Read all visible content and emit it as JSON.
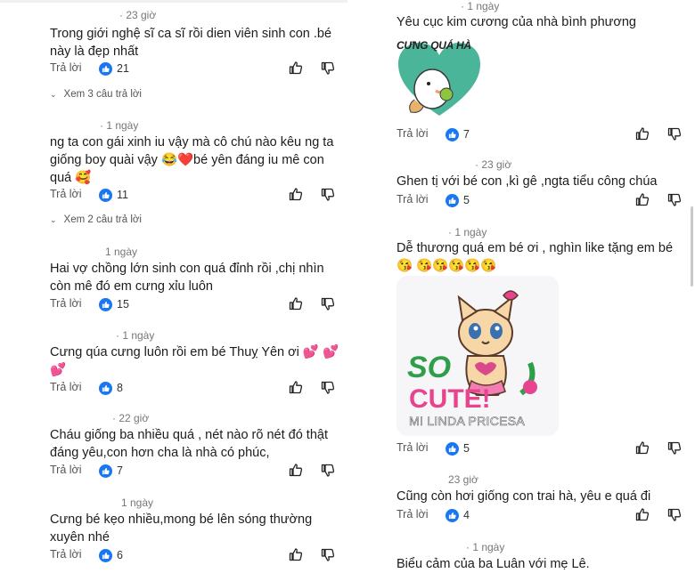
{
  "colors": {
    "like_blue": "#1a77f2",
    "text": "#1c1c1c",
    "meta": "#777777"
  },
  "reply_label": "Trả lời",
  "left": {
    "comments": [
      {
        "time": "· 23 giờ",
        "text": "Trong giới nghệ sĩ ca sĩ rồi dien viên sinh con .bé này là đẹp nhất",
        "likes": "21",
        "more_replies": "Xem 3 câu trả lời"
      },
      {
        "time": "· 1 ngày",
        "text": "ng ta con gái xinh iu vậy mà cô chú nào kêu ng ta giống boy quài vậy 😂❤️bé yên đáng iu mê con quá 🥰",
        "likes": "11",
        "more_replies": "Xem 2 câu trả lời"
      },
      {
        "time": "1 ngày",
        "text": "Hai vợ chồng lớn sinh con quá đỉnh rồi ,chị nhìn còn mê đó em cưng xỉu luôn",
        "likes": "15"
      },
      {
        "time": "· 1 ngày",
        "text": "Cưng qúa cưng luôn rồi em bé Thuỵ Yên ơi 💕 💕 💕",
        "likes": "8"
      },
      {
        "time": "· 22 giờ",
        "text": "Cháu giống ba nhiều quá , nét nào rõ nét đó thật đáng yêu,con hơn cha là nhà có phúc,",
        "likes": "7"
      },
      {
        "time": "1 ngày",
        "text": "Cưng bé kẹo nhiều,mong bé lên sóng thường xuyên nhé",
        "likes": "6"
      }
    ]
  },
  "right": {
    "comments": [
      {
        "time": "· 1 ngày",
        "text": "Yêu cục kim cương của nhà bình phương",
        "likes": "7",
        "sticker": {
          "type": "heart-sticker",
          "caption": "CƯNG QUÁ HÀ"
        }
      },
      {
        "time": "· 23 giờ",
        "text": "Ghen tị với bé con ,kì gê ,ngta tiểu công chúa",
        "likes": "5"
      },
      {
        "time": "· 1 ngày",
        "text": "Dễ thương quá em bé ơi , nghìn like tặng em bé 😘 😘😘😘😘😘",
        "likes": "5",
        "sticker": {
          "type": "cat-sticker",
          "word1": "SO",
          "word2": "CUTE!",
          "watermark": "MI LINDA PRICESA"
        }
      },
      {
        "time": "23 giờ",
        "text": "Cũng còn hơi giống con trai hà, yêu e quá đi",
        "likes": "4"
      },
      {
        "time": "· 1 ngày",
        "text": "Biểu cảm của ba Luân với mẹ Lê."
      }
    ]
  }
}
